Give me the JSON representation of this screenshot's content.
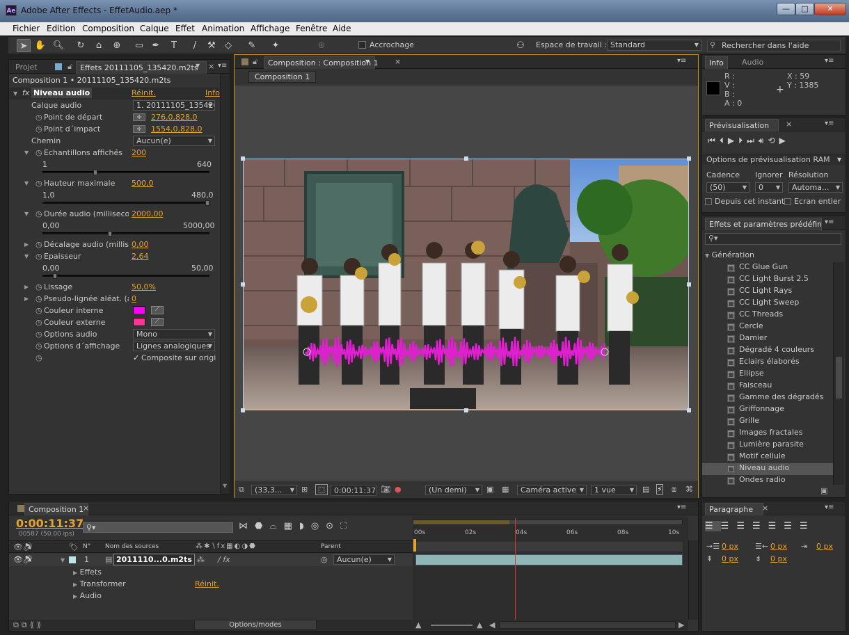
{
  "app": {
    "title": "Adobe After Effects - EffetAudio.aep *",
    "logo": "Ae"
  },
  "window_controls": {
    "minimize": "—",
    "maximize": "□",
    "close": "✕"
  },
  "menu": [
    "Fichier",
    "Edition",
    "Composition",
    "Calque",
    "Effet",
    "Animation",
    "Affichage",
    "Fenêtre",
    "Aide"
  ],
  "toolbar": {
    "snapping_label": "Accrochage",
    "workspace_label": "Espace de travail :",
    "workspace_value": "Standard",
    "help_search_placeholder": "Rechercher dans l'aide"
  },
  "effects_panel": {
    "tab_project": "Projet",
    "tab_effects": "Effets 20111105_135420.m2ts",
    "breadcrumb": "Composition 1 • 20111105_135420.m2ts",
    "effect_name": "Niveau audio",
    "reset": "Réinit.",
    "info": "Info",
    "params": [
      {
        "label": "Calque audio",
        "value": "1. 20111105_135420"
      },
      {
        "label": "Point de départ",
        "value": "276,0,828,0"
      },
      {
        "label": "Point d´impact",
        "value": "1554,0,828,0"
      },
      {
        "label": "Chemin",
        "value": "Aucun(e)"
      },
      {
        "label": "Echantillons affichés",
        "value": "200",
        "min": "1",
        "max": "640"
      },
      {
        "label": "Hauteur maximale",
        "value": "500,0",
        "min": "1,0",
        "max": "480,0"
      },
      {
        "label": "Durée audio (millisecon",
        "value": "2000,00",
        "min": "0,00",
        "max": "5000,00"
      },
      {
        "label": "Décalage audio (millise",
        "value": "0,00"
      },
      {
        "label": "Epaisseur",
        "value": "2,64",
        "min": "0,00",
        "max": "50,00"
      },
      {
        "label": "Lissage",
        "value": "50,0%"
      },
      {
        "label": "Pseudo-lignée aléat. (a",
        "value": "0"
      },
      {
        "label": "Couleur interne",
        "value": "#ff00ff"
      },
      {
        "label": "Couleur externe",
        "value": "#ff3399"
      },
      {
        "label": "Options audio",
        "value": "Mono"
      },
      {
        "label": "Options d´affichage",
        "value": "Lignes analogiques"
      },
      {
        "label": "",
        "value": "Composite sur origi"
      }
    ]
  },
  "comp_viewer": {
    "tab": "Composition : Composition 1",
    "sub_tab": "Composition 1",
    "zoom": "(33,3...",
    "timecode": "0:00:11:37",
    "resolution": "(Un demi)",
    "camera": "Caméra active",
    "views": "1 vue",
    "colors": {
      "waveform": "#e020d0"
    }
  },
  "info_panel": {
    "tab_info": "Info",
    "tab_audio": "Audio",
    "r": "R :",
    "v": "V :",
    "b": "B :",
    "a": "A : 0",
    "x": "X : 59",
    "y": "Y : 1385"
  },
  "preview_panel": {
    "tab": "Prévisualisation",
    "ram_options": "Options de prévisualisation RAM",
    "cadence_label": "Cadence",
    "ignore_label": "Ignorer",
    "resolution_label": "Résolution",
    "cadence": "(50)",
    "ignore": "0",
    "resolution": "Automa...",
    "from_current": "Depuis cet instant",
    "full_screen": "Ecran entier"
  },
  "effects_presets": {
    "tab": "Effets et paramètres prédéfinis",
    "category": "Génération",
    "items": [
      "CC Glue Gun",
      "CC Light Burst 2.5",
      "CC Light Rays",
      "CC Light Sweep",
      "CC Threads",
      "Cercle",
      "Damier",
      "Dégradé 4 couleurs",
      "Eclairs élaborés",
      "Ellipse",
      "Faisceau",
      "Gamme des dégradés",
      "Griffonnage",
      "Grille",
      "Images fractales",
      "Lumière parasite",
      "Motif cellule",
      "Niveau audio",
      "Ondes radio"
    ],
    "selected": "Niveau audio"
  },
  "timeline": {
    "tab": "Composition 1",
    "timecode": "0:00:11:37",
    "frames": "00587 (50.00 ips)",
    "col_no": "N°",
    "col_source": "Nom des sources",
    "col_parent": "Parent",
    "layer_no": "1",
    "layer_name": "2011110...0.m2ts",
    "parent_value": "Aucun(e)",
    "sub_effects": "Effets",
    "sub_transform": "Transformer",
    "sub_audio": "Audio",
    "reset": "Réinit.",
    "options_modes": "Options/modes",
    "ruler": [
      "00s",
      "02s",
      "04s",
      "06s",
      "08s",
      "10s"
    ],
    "current_time_pct": 38
  },
  "paragraph_panel": {
    "tab": "Paragraphe",
    "px": [
      "0 px",
      "0 px",
      "0 px",
      "0 px",
      "0 px"
    ]
  }
}
